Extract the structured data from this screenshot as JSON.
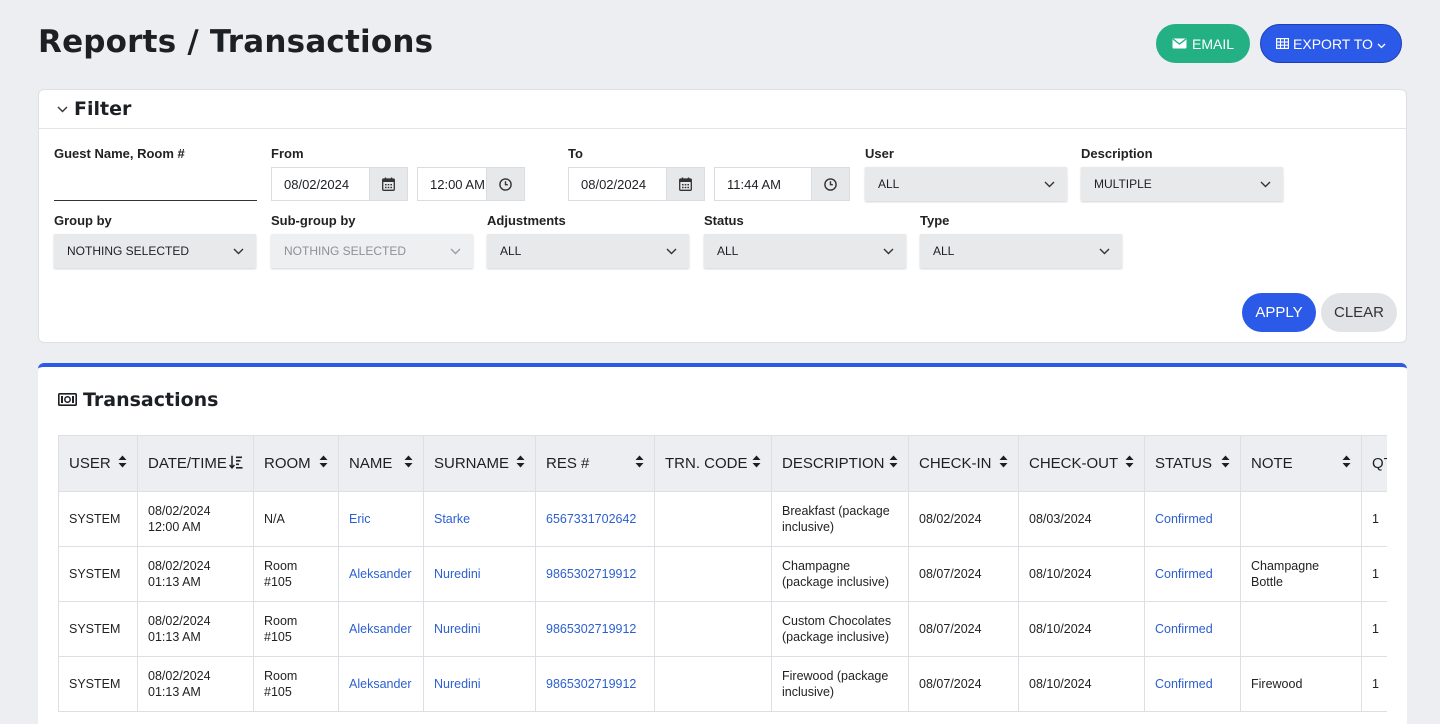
{
  "header": {
    "title": "Reports / Transactions",
    "email_label": "EMAIL",
    "export_label": "EXPORT TO"
  },
  "filter": {
    "title": "Filter",
    "guest_label": "Guest Name, Room #",
    "guest_value": "",
    "from_label": "From",
    "from_date": "08/02/2024",
    "from_time": "12:00 AM",
    "to_label": "To",
    "to_date": "08/02/2024",
    "to_time": "11:44 AM",
    "user_label": "User",
    "user_value": "ALL",
    "description_label": "Description",
    "description_value": "MULTIPLE",
    "groupby_label": "Group by",
    "groupby_value": "NOTHING SELECTED",
    "subgroup_label": "Sub-group by",
    "subgroup_value": "NOTHING SELECTED",
    "adjustments_label": "Adjustments",
    "adjustments_value": "ALL",
    "status_label": "Status",
    "status_value": "ALL",
    "type_label": "Type",
    "type_value": "ALL",
    "apply_label": "APPLY",
    "clear_label": "CLEAR"
  },
  "transactions": {
    "title": "Transactions",
    "columns": [
      "USER",
      "DATE/TIME",
      "ROOM",
      "NAME",
      "SURNAME",
      "RES #",
      "TRN. CODE",
      "DESCRIPTION",
      "CHECK-IN",
      "CHECK-OUT",
      "STATUS",
      "NOTE",
      "QTY"
    ],
    "rows": [
      {
        "user": "SYSTEM",
        "date": "08/02/2024",
        "time": "12:00 AM",
        "room1": "N/A",
        "room2": "",
        "name": "Eric",
        "surname": "Starke",
        "res": "6567331702642",
        "trn": "",
        "desc1": "Breakfast (package",
        "desc2": "inclusive)",
        "checkin": "08/02/2024",
        "checkout": "08/03/2024",
        "status": "Confirmed",
        "note1": "",
        "note2": "",
        "qty": "1"
      },
      {
        "user": "SYSTEM",
        "date": "08/02/2024",
        "time": "01:13 AM",
        "room1": "Room",
        "room2": "#105",
        "name": "Aleksander",
        "surname": "Nuredini",
        "res": "9865302719912",
        "trn": "",
        "desc1": "Champagne",
        "desc2": "(package inclusive)",
        "checkin": "08/07/2024",
        "checkout": "08/10/2024",
        "status": "Confirmed",
        "note1": "Champagne",
        "note2": "Bottle",
        "qty": "1"
      },
      {
        "user": "SYSTEM",
        "date": "08/02/2024",
        "time": "01:13 AM",
        "room1": "Room",
        "room2": "#105",
        "name": "Aleksander",
        "surname": "Nuredini",
        "res": "9865302719912",
        "trn": "",
        "desc1": "Custom Chocolates",
        "desc2": "(package inclusive)",
        "checkin": "08/07/2024",
        "checkout": "08/10/2024",
        "status": "Confirmed",
        "note1": "",
        "note2": "",
        "qty": "1"
      },
      {
        "user": "SYSTEM",
        "date": "08/02/2024",
        "time": "01:13 AM",
        "room1": "Room",
        "room2": "#105",
        "name": "Aleksander",
        "surname": "Nuredini",
        "res": "9865302719912",
        "trn": "",
        "desc1": "Firewood (package",
        "desc2": "inclusive)",
        "checkin": "08/07/2024",
        "checkout": "08/10/2024",
        "status": "Confirmed",
        "note1": "Firewood",
        "note2": "",
        "qty": "1"
      }
    ]
  }
}
